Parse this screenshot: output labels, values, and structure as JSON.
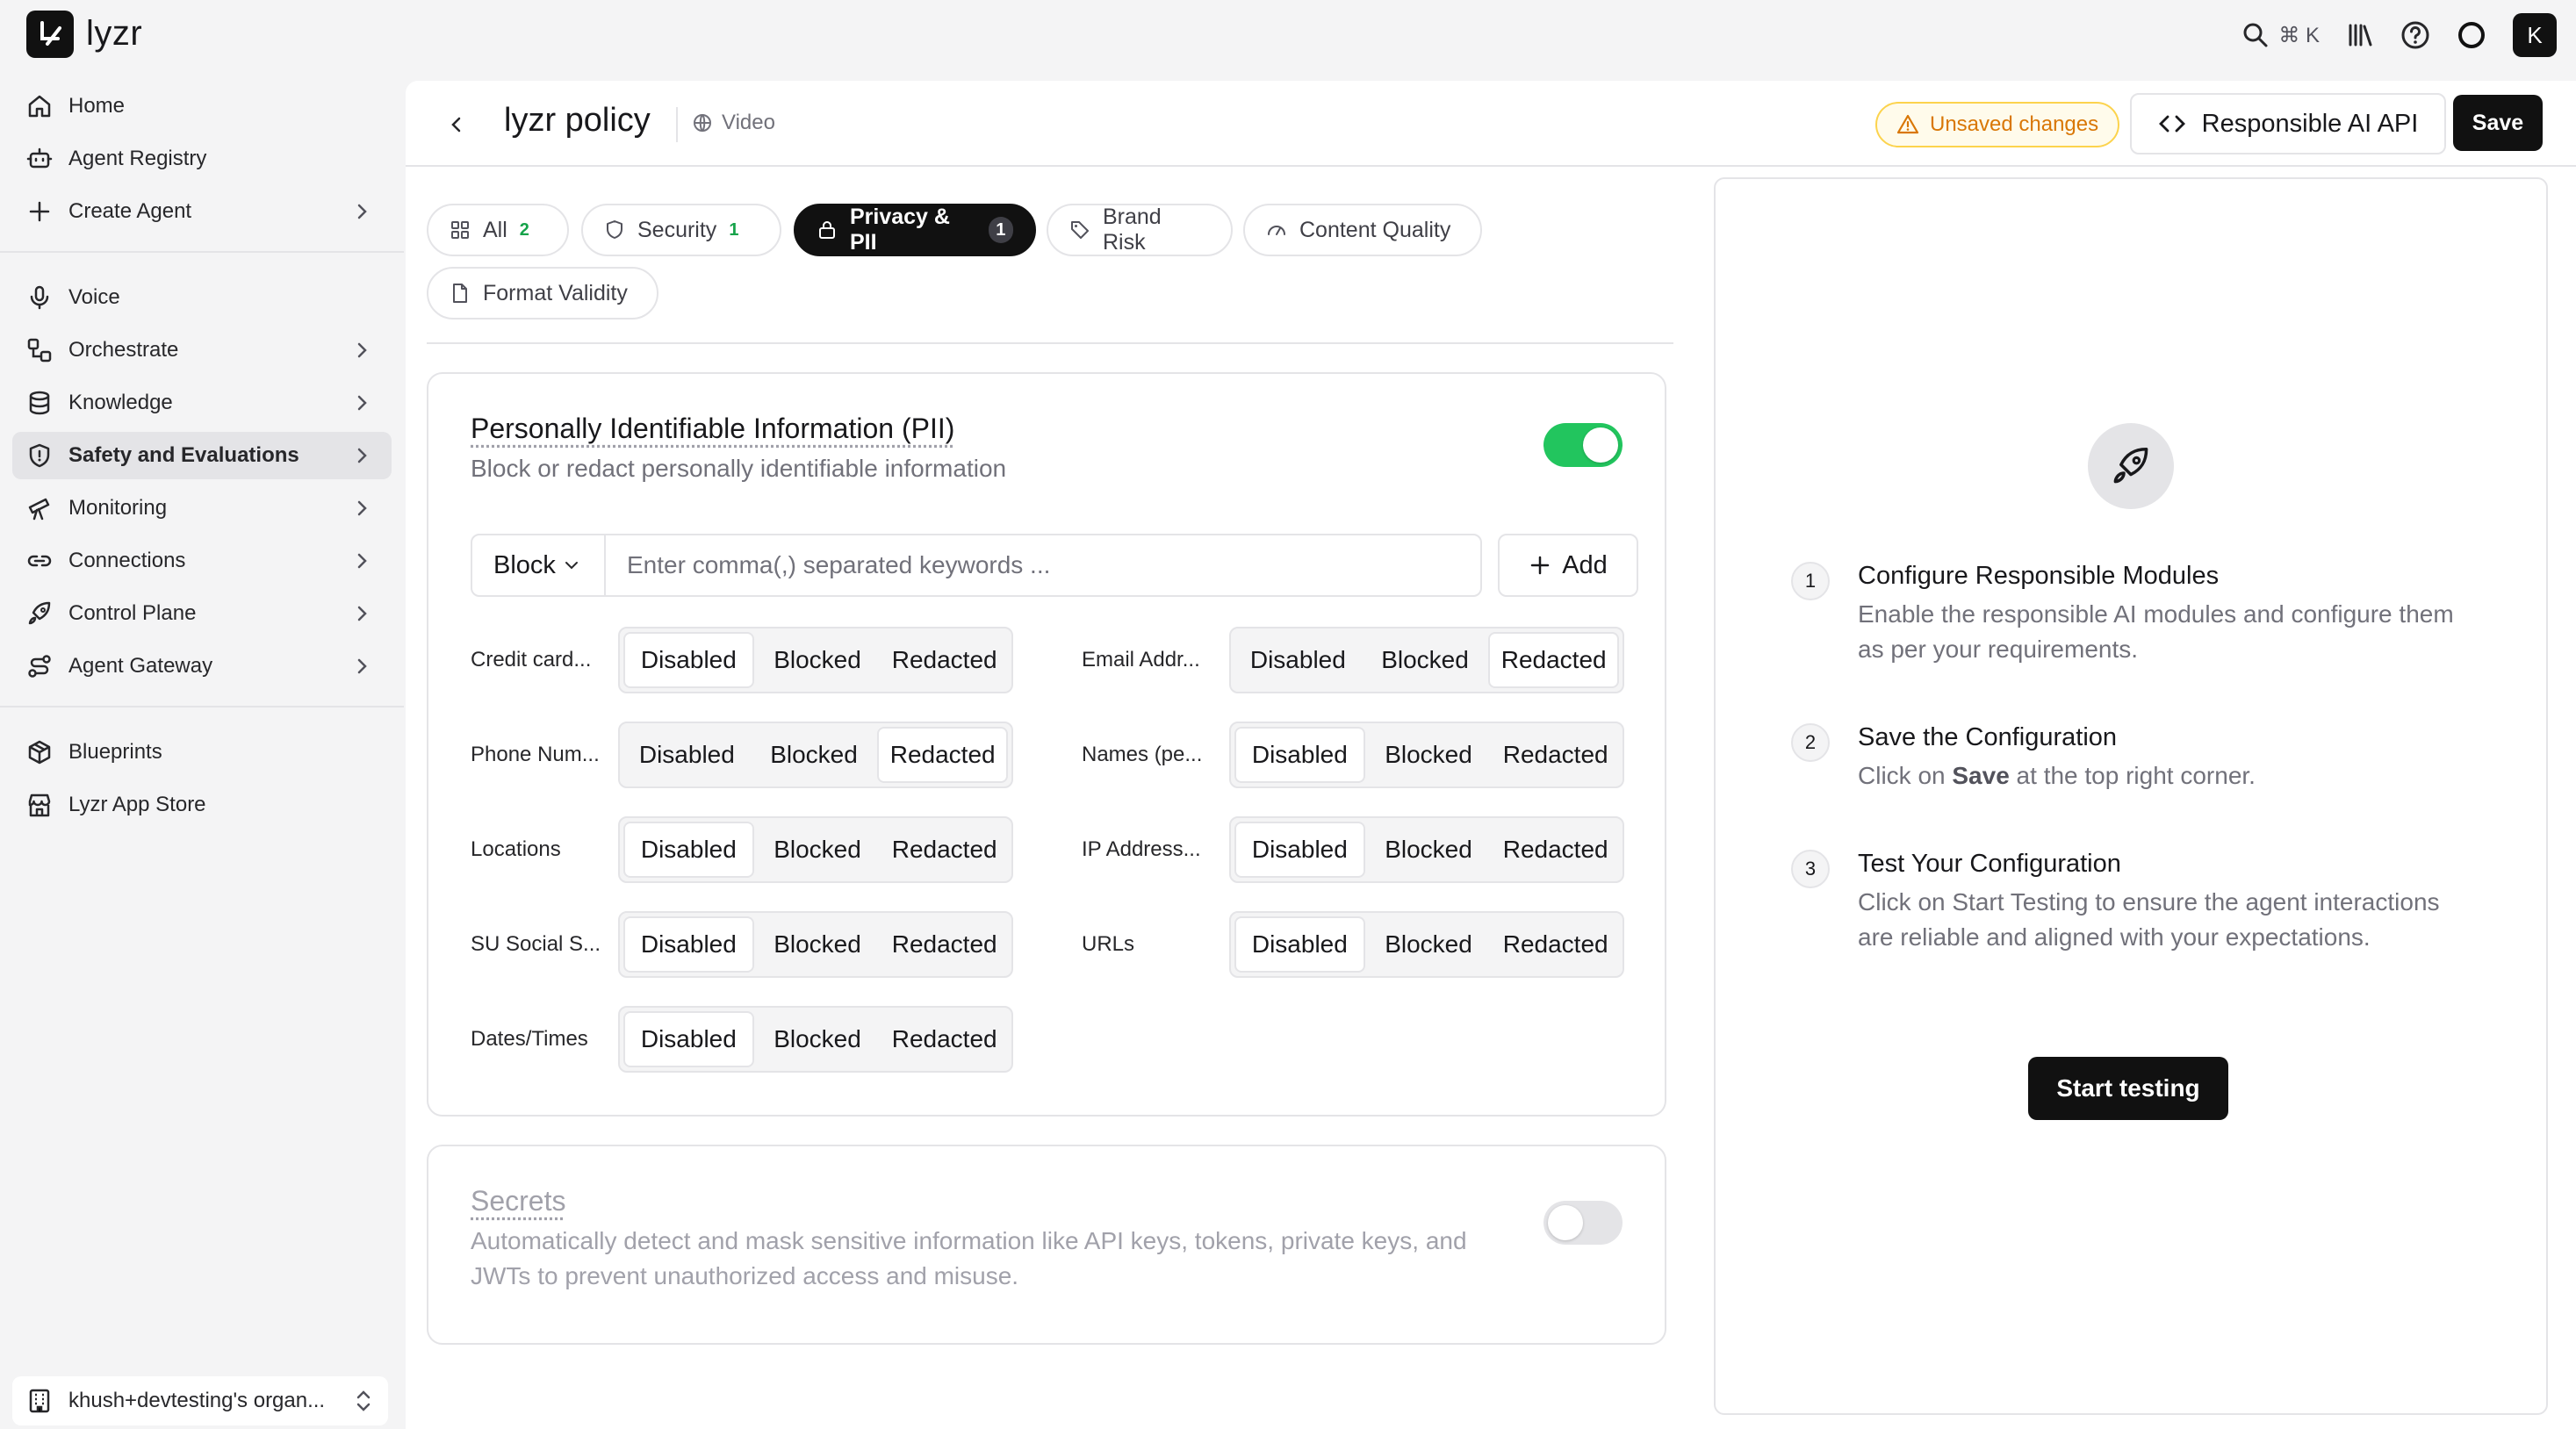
{
  "brand": {
    "name": "lyzr"
  },
  "topbar": {
    "search_shortcut": "⌘ K",
    "avatar_initial": "K"
  },
  "sidebar": {
    "items": [
      {
        "label": "Home"
      },
      {
        "label": "Agent Registry"
      },
      {
        "label": "Create Agent"
      },
      {
        "label": "Voice"
      },
      {
        "label": "Orchestrate"
      },
      {
        "label": "Knowledge"
      },
      {
        "label": "Safety and Evaluations"
      },
      {
        "label": "Monitoring"
      },
      {
        "label": "Connections"
      },
      {
        "label": "Control Plane"
      },
      {
        "label": "Agent Gateway"
      },
      {
        "label": "Blueprints"
      },
      {
        "label": "Lyzr App Store"
      }
    ],
    "org_name": "khush+devtesting's organ..."
  },
  "header": {
    "title": "lyzr policy",
    "tag": "Video",
    "unsaved": "Unsaved changes",
    "api_button": "Responsible AI API",
    "save_button": "Save"
  },
  "tabs": [
    {
      "label": "All",
      "count": "2"
    },
    {
      "label": "Security",
      "count": "1"
    },
    {
      "label": "Privacy & PII",
      "count": "1"
    },
    {
      "label": "Brand Risk"
    },
    {
      "label": "Content Quality"
    },
    {
      "label": "Format Validity"
    }
  ],
  "pii_card": {
    "title": "Personally Identifiable Information (PII)",
    "description": "Block or redact personally identifiable information",
    "enabled": true,
    "mode_select": "Block",
    "keywords_placeholder": "Enter comma(,) separated keywords ...",
    "add_button": "Add",
    "options": [
      "Disabled",
      "Blocked",
      "Redacted"
    ],
    "items": [
      {
        "label": "Credit card...",
        "selected": "Disabled"
      },
      {
        "label": "Email Addr...",
        "selected": "Redacted"
      },
      {
        "label": "Phone Num...",
        "selected": "Redacted"
      },
      {
        "label": "Names (pe...",
        "selected": "Disabled"
      },
      {
        "label": "Locations",
        "selected": "Disabled"
      },
      {
        "label": "IP Address...",
        "selected": "Disabled"
      },
      {
        "label": "SU Social S...",
        "selected": "Disabled"
      },
      {
        "label": "URLs",
        "selected": "Disabled"
      },
      {
        "label": "Dates/Times",
        "selected": "Disabled"
      }
    ]
  },
  "secrets_card": {
    "title": "Secrets",
    "description": "Automatically detect and mask sensitive information like API keys, tokens, private keys, and JWTs to prevent unauthorized access and misuse.",
    "enabled": false
  },
  "guide": {
    "steps": [
      {
        "num": "1",
        "title": "Configure Responsible Modules",
        "desc": "Enable the responsible AI modules and configure them as per your requirements."
      },
      {
        "num": "2",
        "title": "Save the Configuration",
        "desc_pre": "Click on ",
        "desc_bold": "Save",
        "desc_post": " at the top right corner."
      },
      {
        "num": "3",
        "title": "Test Your Configuration",
        "desc": "Click on Start Testing to ensure the agent interactions are reliable and aligned with your expectations."
      }
    ],
    "start_button": "Start testing"
  },
  "colors": {
    "accent_green": "#22c55e",
    "warning": "#d97706",
    "dark": "#111111"
  }
}
